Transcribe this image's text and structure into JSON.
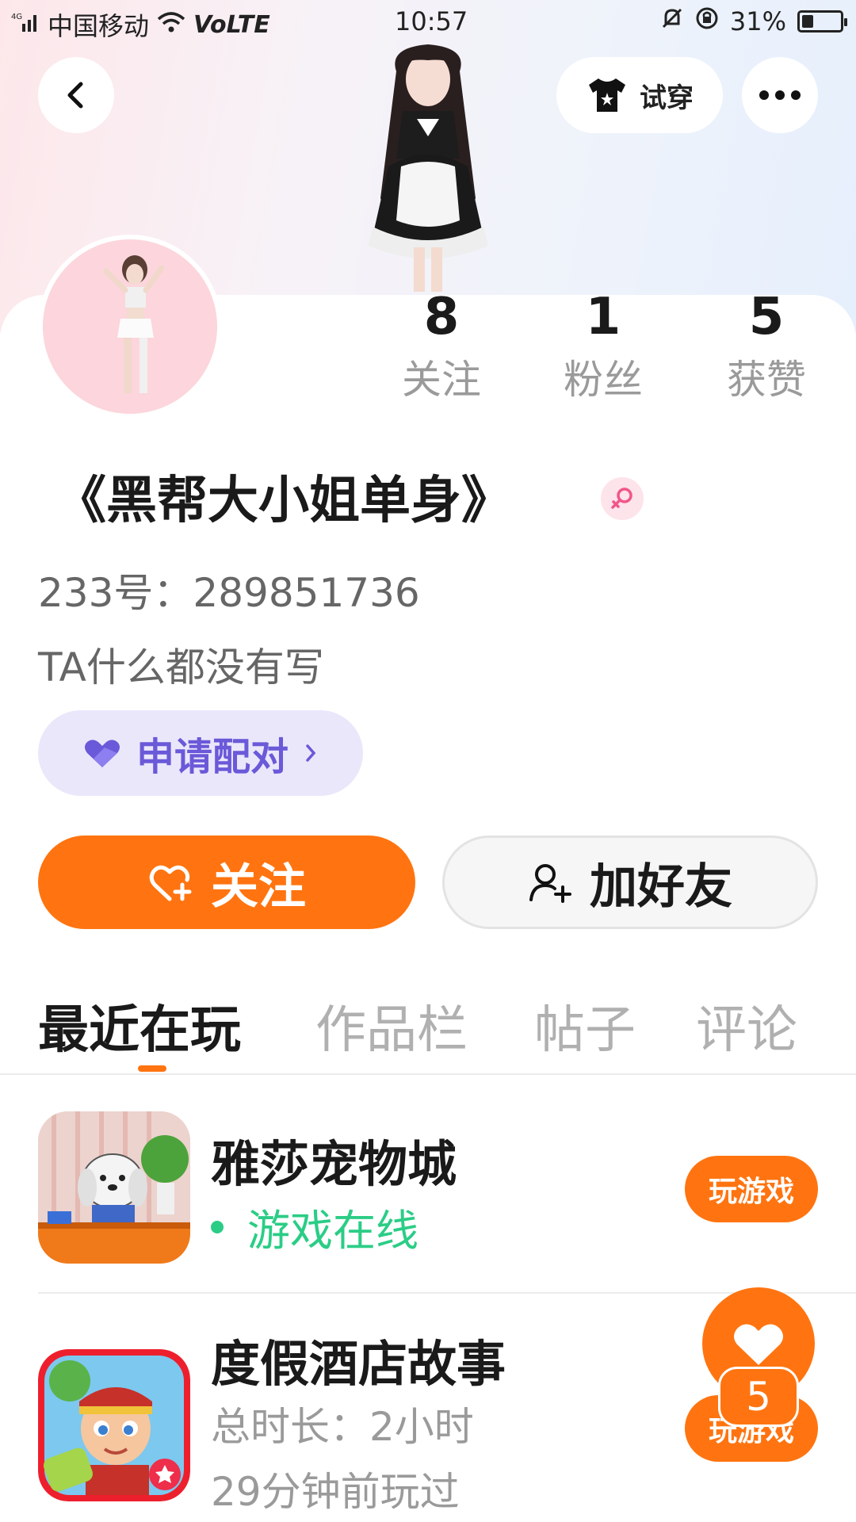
{
  "status_bar": {
    "network_type": "4G",
    "carrier": "中国移动",
    "volte": "VoLTE",
    "time": "10:57",
    "battery": "31%",
    "battery_level": 0.31
  },
  "header": {
    "back_icon": "chevron-left-icon",
    "try_on_label": "试穿",
    "try_on_icon": "tshirt-icon",
    "more_icon": "more-dots-icon"
  },
  "profile": {
    "stats": [
      {
        "value": "8",
        "label": "关注"
      },
      {
        "value": "1",
        "label": "粉丝"
      },
      {
        "value": "5",
        "label": "获赞"
      }
    ],
    "name": "《黑帮大小姐单身》",
    "gender_icon": "female-icon",
    "id_line": "233号：289851736",
    "bio": "TA什么都没有写",
    "match_label": "申请配对",
    "match_icon": "heart-icon"
  },
  "actions": {
    "follow_label": "关注",
    "add_friend_label": "加好友"
  },
  "tabs": [
    {
      "label": "最近在玩",
      "active": true
    },
    {
      "label": "作品栏",
      "active": false
    },
    {
      "label": "帖子",
      "active": false
    },
    {
      "label": "评论",
      "active": false
    }
  ],
  "games": [
    {
      "title": "雅莎宠物城",
      "status": "游戏在线",
      "button": "玩游戏"
    },
    {
      "title": "度假酒店故事",
      "duration": "总时长：2小时",
      "last_played": "29分钟前玩过",
      "button": "玩游戏"
    }
  ],
  "like_fab": {
    "count": "5",
    "icon": "heart-icon"
  },
  "colors": {
    "accent": "#ff7410",
    "online": "#2bcd86",
    "match_purple": "#6a59d8"
  }
}
